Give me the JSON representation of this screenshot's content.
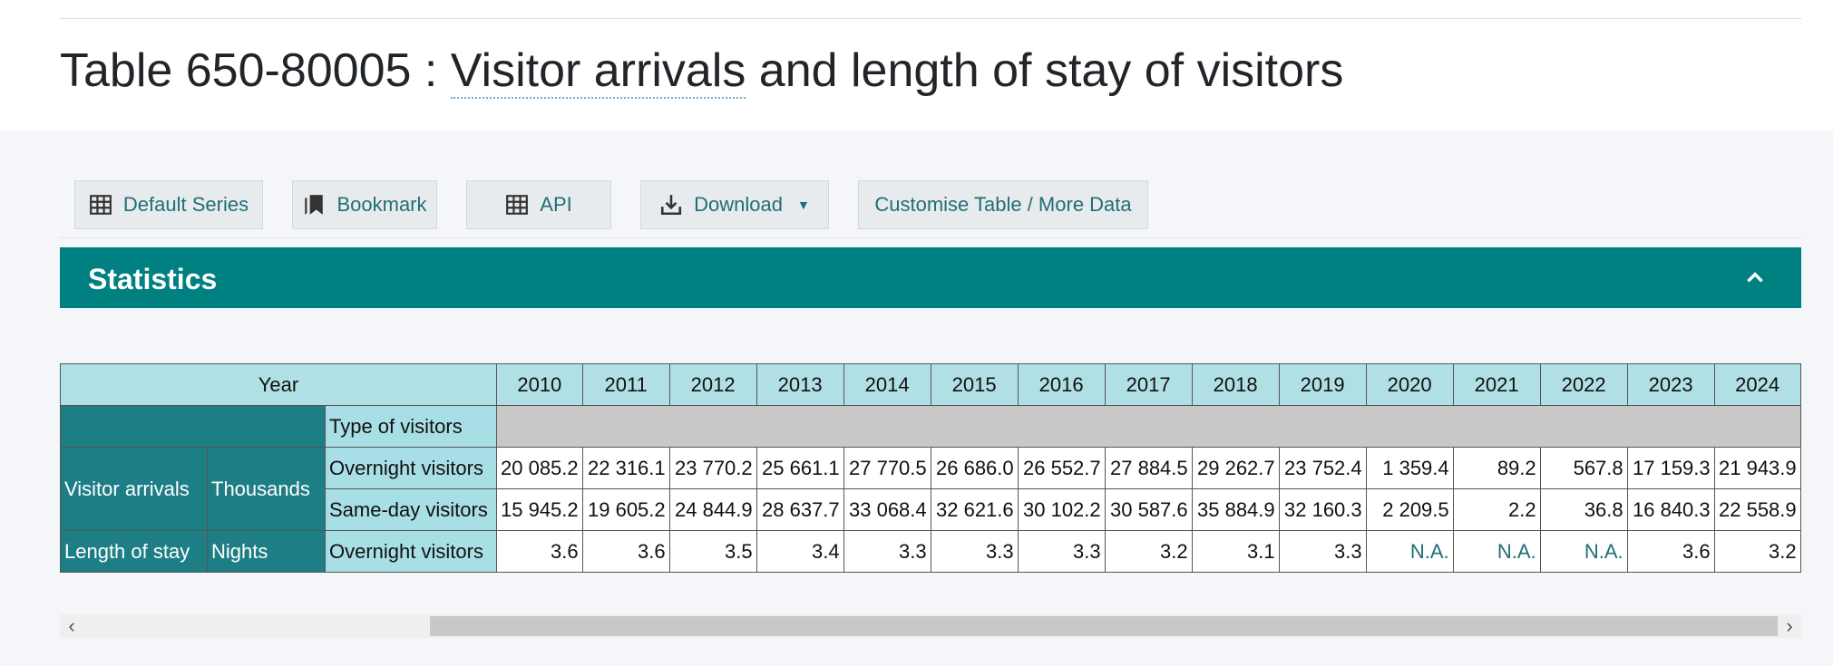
{
  "page": {
    "title_prefix": "Table 650-80005 : ",
    "title_link": "Visitor arrivals",
    "title_suffix": " and length of stay of visitors"
  },
  "toolbar": {
    "default_series": "Default Series",
    "bookmark": "Bookmark",
    "api": "API",
    "download": "Download",
    "customise": "Customise Table / More Data"
  },
  "panel": {
    "title": "Statistics"
  },
  "table": {
    "year_header": "Year",
    "years": [
      "2010",
      "2011",
      "2012",
      "2013",
      "2014",
      "2015",
      "2016",
      "2017",
      "2018",
      "2019",
      "2020",
      "2021",
      "2022",
      "2023",
      "2024"
    ],
    "type_header": "Type of visitors",
    "group_arrivals": "Visitor arrivals",
    "unit_thousands": "Thousands",
    "group_stay": "Length of stay",
    "unit_nights": "Nights",
    "rows": [
      {
        "type": "Overnight visitors",
        "values": [
          "20 085.2",
          "22 316.1",
          "23 770.2",
          "25 661.1",
          "27 770.5",
          "26 686.0",
          "26 552.7",
          "27 884.5",
          "29 262.7",
          "23 752.4",
          "1 359.4",
          "89.2",
          "567.8",
          "17 159.3",
          "21 943.9"
        ]
      },
      {
        "type": "Same-day visitors",
        "values": [
          "15 945.2",
          "19 605.2",
          "24 844.9",
          "28 637.7",
          "33 068.4",
          "32 621.6",
          "30 102.2",
          "30 587.6",
          "35 884.9",
          "32 160.3",
          "2 209.5",
          "2.2",
          "36.8",
          "16 840.3",
          "22 558.9"
        ]
      },
      {
        "type": "Overnight visitors",
        "values": [
          "3.6",
          "3.6",
          "3.5",
          "3.4",
          "3.3",
          "3.3",
          "3.3",
          "3.2",
          "3.1",
          "3.3",
          "N.A.",
          "N.A.",
          "N.A.",
          "3.6",
          "3.2"
        ]
      }
    ]
  },
  "colors": {
    "accent": "#008080",
    "header_light": "#b0e0e6",
    "label_dark": "#1e7e86",
    "link": "#1f6f77"
  }
}
